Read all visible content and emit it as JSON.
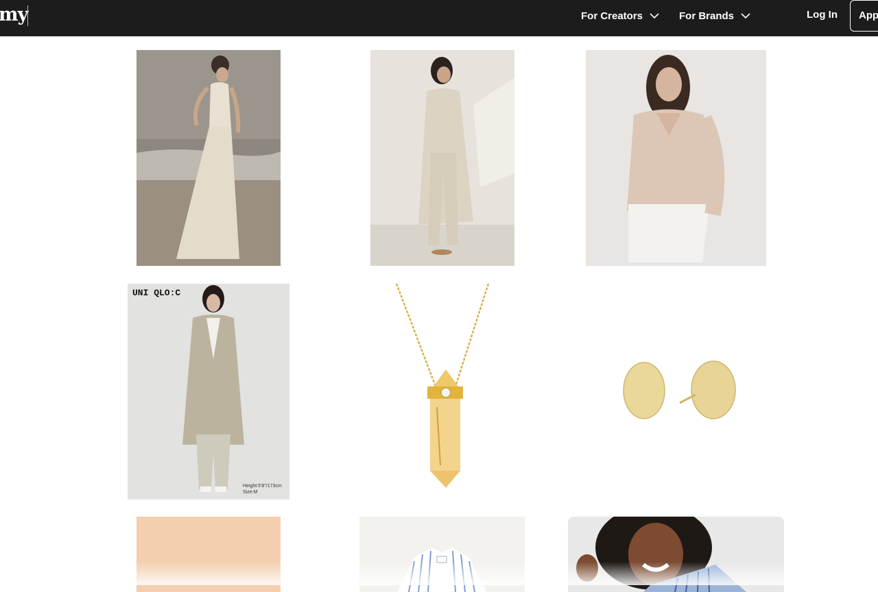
{
  "nav": {
    "logo": "my",
    "items": [
      {
        "label": "For Creators"
      },
      {
        "label": "For Brands"
      }
    ],
    "login": "Log In",
    "apply": "App"
  },
  "products": {
    "uniqlo_badge": "UNI QLO:C",
    "model_height": "Height:5'8\"/173cm",
    "model_size": "Size:M"
  },
  "colors": {
    "nav_bg": "#1c1c1c",
    "page_bg": "#ffffff"
  }
}
